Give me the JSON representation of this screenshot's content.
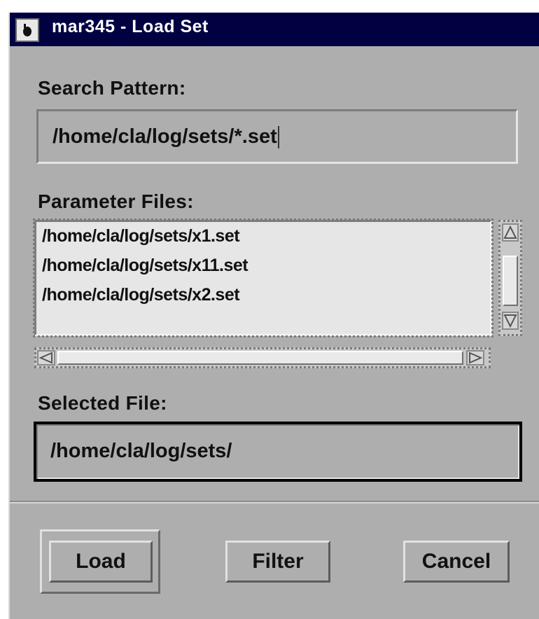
{
  "window": {
    "title": "mar345 - Load Set",
    "icon": "app-icon"
  },
  "search": {
    "label": "Search Pattern:",
    "value": "/home/cla/log/sets/*.set"
  },
  "files": {
    "label": "Parameter Files:",
    "items": [
      "/home/cla/log/sets/x1.set",
      "/home/cla/log/sets/x11.set",
      "/home/cla/log/sets/x2.set"
    ]
  },
  "selected": {
    "label": "Selected File:",
    "value": "/home/cla/log/sets/"
  },
  "buttons": {
    "load": "Load",
    "filter": "Filter",
    "cancel": "Cancel"
  },
  "colors": {
    "title_bar": "#010142",
    "window_bg": "#aeaeae",
    "list_bg": "#e6e6e6"
  }
}
